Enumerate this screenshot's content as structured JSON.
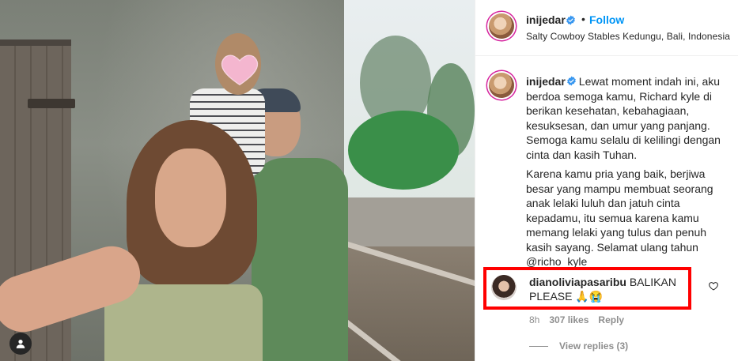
{
  "post": {
    "author": {
      "username": "inijedar",
      "verified": true,
      "follow_label": "Follow",
      "separator": "•",
      "location": "Salty Cowboy Stables Kedungu, Bali, Indonesia"
    },
    "caption": {
      "username": "inijedar",
      "paragraph1": "Lewat moment indah ini, aku berdoa semoga kamu, Richard kyle di berikan kesehatan, kebahagiaan, kesuksesan, dan umur yang panjang. Semoga kamu selalu di kelilingi dengan cinta dan kasih Tuhan.",
      "paragraph2": "Karena kamu pria yang baik, berjiwa besar yang mampu membuat seorang anak lelaki luluh dan jatuh cinta kepadamu, itu semua karena kamu memang lelaki yang tulus dan penuh kasih sayang. Selamat ulang tahun",
      "mention": "@richo_kyle"
    },
    "comment": {
      "username": "dianoliviapasaribu",
      "text": "BALIKAN PLEASE",
      "emojis": "🙏😭",
      "time": "8h",
      "likes": "307 likes",
      "reply_label": "Reply",
      "view_replies": "View replies (3)",
      "highlight_color": "#ff0000"
    }
  },
  "colors": {
    "link_blue": "#0095f6",
    "text": "#262626",
    "muted": "#8e8e8e"
  },
  "icons": {
    "verified": "verified-badge-icon",
    "heart": "heart-outline-icon",
    "user_tag": "user-tag-icon",
    "face_cover": "pink-heart-sticker"
  }
}
